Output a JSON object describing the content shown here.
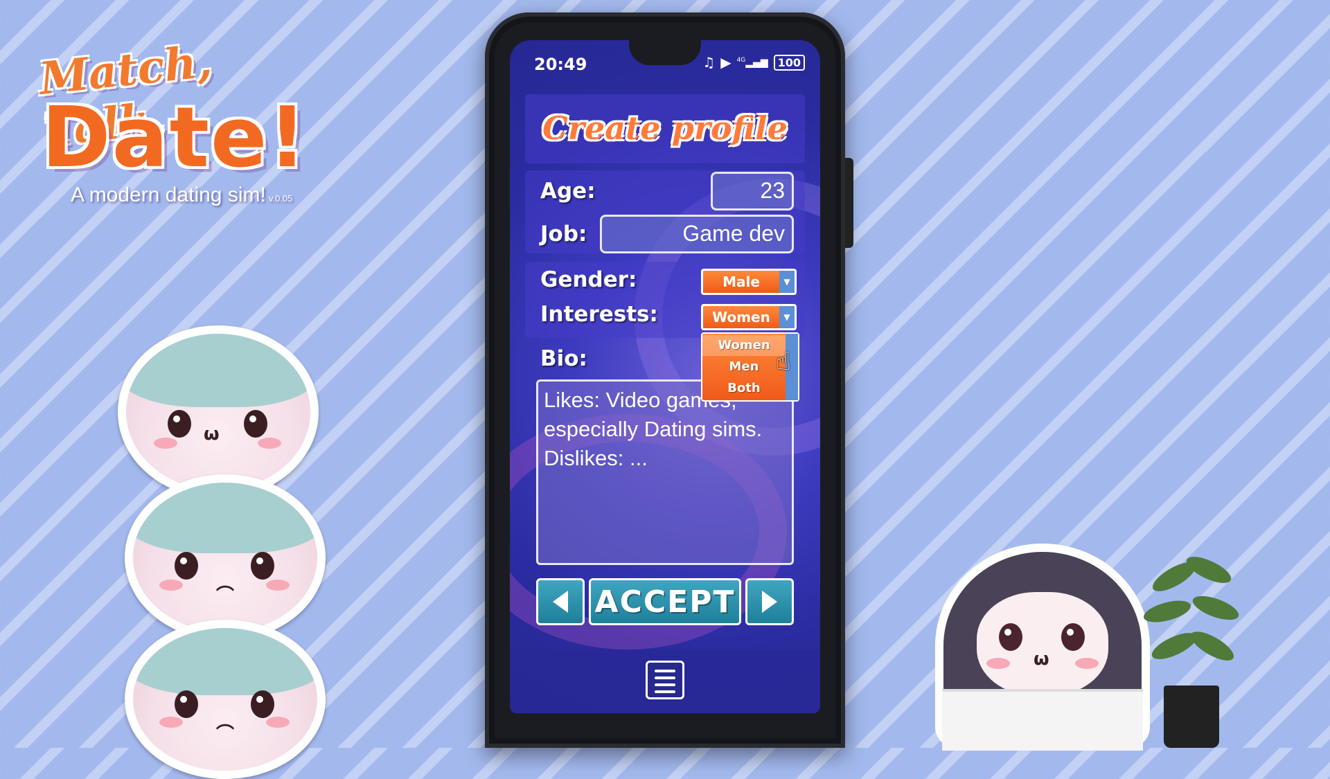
{
  "logo": {
    "line1": "Match, Talk,",
    "line2": "Date!",
    "subtitle": "A modern dating sim!",
    "version": "v.0.05"
  },
  "status_bar": {
    "time": "20:49",
    "network": "4G",
    "battery": "100"
  },
  "profile": {
    "title": "Create profile",
    "age_label": "Age:",
    "age_value": "23",
    "job_label": "Job:",
    "job_value": "Game dev",
    "gender_label": "Gender:",
    "gender_value": "Male",
    "interests_label": "Interests:",
    "interests_value": "Women",
    "interests_options": [
      "Women",
      "Men",
      "Both"
    ],
    "bio_label": "Bio:",
    "bio_text": "Likes: Video games, especially Dating sims. Dislikes: ..."
  },
  "nav": {
    "accept_label": "ACCEPT"
  },
  "colors": {
    "accent_orange": "#f26a22",
    "button_teal": "#2a92ad",
    "screen_blue": "#2a2b9e"
  },
  "icons": [
    "signal-icon",
    "play-icon",
    "music-off-icon",
    "battery-icon",
    "hand-cursor-icon",
    "arrow-left-icon",
    "arrow-right-icon",
    "menu-icon"
  ]
}
